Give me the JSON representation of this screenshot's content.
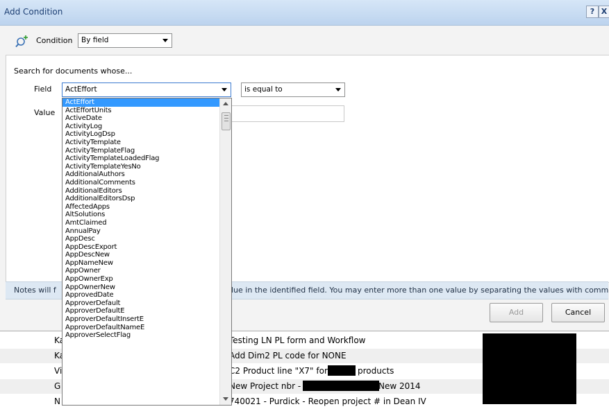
{
  "dialog": {
    "title": "Add Condition",
    "help_button": "?",
    "close_button": "X",
    "condition_label": "Condition",
    "condition_value": "By field",
    "search_label": "Search for documents whose...",
    "field_label": "Field",
    "field_value": "ActEffort",
    "operator_value": "is equal to",
    "value_label": "Value",
    "value_input": "",
    "notes_left": "Notes will f",
    "notes_right": "lue in the identified field.  You may enter more than one value by separating the values with commas.",
    "add_button": "Add",
    "cancel_button": "Cancel"
  },
  "field_dropdown": {
    "selected_index": 0,
    "items": [
      "ActEffort",
      "ActEffortUnits",
      "ActiveDate",
      "ActivityLog",
      "ActivityLogDsp",
      "ActivityTemplate",
      "ActivityTemplateFlag",
      "ActivityTemplateLoadedFlag",
      "ActivityTemplateYesNo",
      "AdditionalAuthors",
      "AdditionalComments",
      "AdditionalEditors",
      "AdditionalEditorsDsp",
      "AffectedApps",
      "AltSolutions",
      "AmtClaimed",
      "AnnualPay",
      "AppDesc",
      "AppDescExport",
      "AppDescNew",
      "AppNameNew",
      "AppOwner",
      "AppOwnerExp",
      "AppOwnerNew",
      "ApprovedDate",
      "ApproverDefault",
      "ApproverDefaultE",
      "ApproverDefaultInsertE",
      "ApproverDefaultNameE",
      "ApproverSelectFlag"
    ]
  },
  "background_rows": [
    {
      "left": "Ka",
      "right": "Testing LN PL form and Workflow"
    },
    {
      "left": "Ka",
      "right": "Add Dim2 PL code for NONE"
    },
    {
      "left": "Vi",
      "right_a": "C2 Product line \"X7\" for ",
      "right_b": "products"
    },
    {
      "left": "G",
      "right_a": "New Project nbr - ",
      "right_b": " New 2014"
    },
    {
      "left": "N",
      "right": "740021 - Purdick - Reopen project # in Dean IV"
    }
  ],
  "icons": {
    "condition": "search-add-icon",
    "scroll_up": "scroll-up-icon",
    "scroll_down": "scroll-down-icon"
  }
}
